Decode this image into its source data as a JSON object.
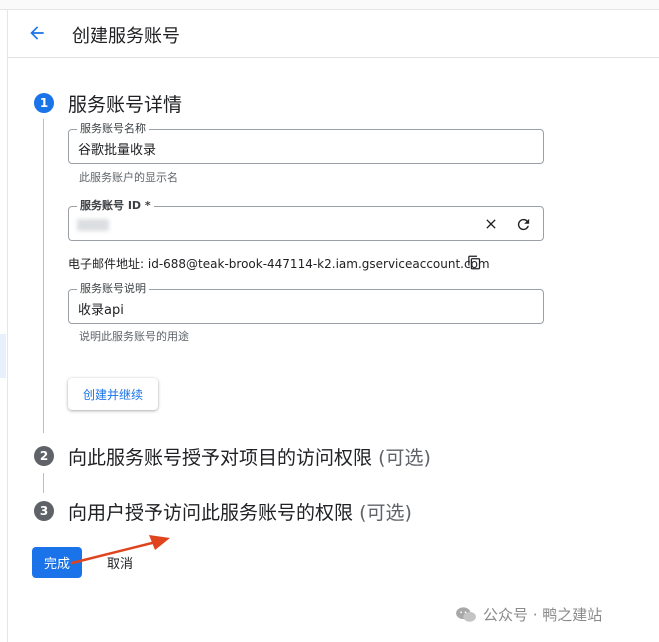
{
  "header": {
    "title": "创建服务账号",
    "back_icon": "arrow-back-icon"
  },
  "steps": [
    {
      "number": "1",
      "title": "服务账号详情",
      "optional": ""
    },
    {
      "number": "2",
      "title": "向此服务账号授予对项目的访问权限",
      "optional": "(可选)"
    },
    {
      "number": "3",
      "title": "向用户授予访问此服务账号的权限",
      "optional": "(可选)"
    }
  ],
  "form": {
    "name_field": {
      "label": "服务账号名称",
      "value": "谷歌批量收录",
      "helper": "此服务账户的显示名"
    },
    "id_field": {
      "label": "服务账号 ID *",
      "clear_icon": "close-icon",
      "refresh_icon": "refresh-icon"
    },
    "email": {
      "label": "电子邮件地址:",
      "value": "id-688@teak-brook-447114-k2.iam.gserviceaccount.com",
      "copy_icon": "copy-icon"
    },
    "description_field": {
      "label": "服务账号说明",
      "value": "收录api",
      "helper": "说明此服务账号的用途"
    },
    "create_continue_label": "创建并继续"
  },
  "footer": {
    "done_label": "完成",
    "cancel_label": "取消"
  },
  "watermark": {
    "text": "公众号 · 鸭之建站",
    "icon": "wechat-icon"
  },
  "colors": {
    "accent": "#1a73e8",
    "annotation_arrow": "#e0441f"
  }
}
